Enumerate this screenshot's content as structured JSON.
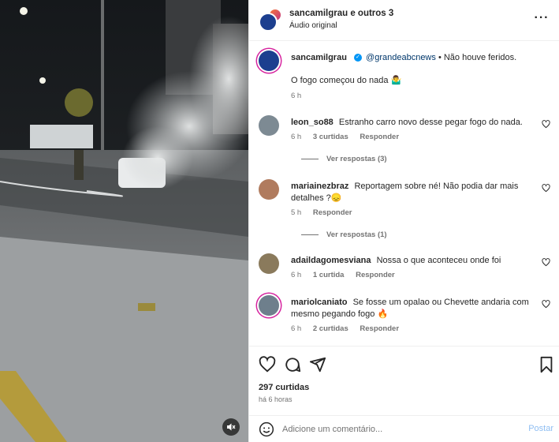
{
  "header": {
    "title": "sancamilgrau e outros 3",
    "subtitle": "Áudio original"
  },
  "caption": {
    "username": "sancamilgrau",
    "mention": "@grandeabcnews",
    "text1": "• Não houve feridos.",
    "text2": "O fogo começou do nada 🤷‍♂️",
    "time": "6 h"
  },
  "comments": [
    {
      "username": "leon_so88",
      "text": "Estranho carro novo desse pegar fogo do nada.",
      "time": "6 h",
      "likes": "3 curtidas",
      "reply_label": "Responder",
      "view_replies": "Ver respostas (3)"
    },
    {
      "username": "mariainezbraz",
      "text": "Reportagem sobre né! Não podia dar mais detalhes ?😞",
      "time": "5 h",
      "reply_label": "Responder",
      "view_replies": "Ver respostas (1)"
    },
    {
      "username": "adaildagomesviana",
      "text": "Nossa o que aconteceu onde foi",
      "time": "6 h",
      "likes": "1 curtida",
      "reply_label": "Responder"
    },
    {
      "username": "mariolcaniato",
      "text": "Se fosse um opalao ou Chevette andaria com mesmo pegando fogo 🔥",
      "time": "6 h",
      "likes": "2 curtidas",
      "reply_label": "Responder"
    }
  ],
  "post": {
    "likes": "297 curtidas",
    "time": "há 6 horas"
  },
  "add_comment": {
    "placeholder": "Adicione um comentário...",
    "post_label": "Postar"
  },
  "icons": [
    "mute-icon",
    "more-icon",
    "heart-icon",
    "comment-icon",
    "share-icon",
    "bookmark-icon",
    "emoji-icon"
  ],
  "colors": {
    "accent": "#0095f6",
    "post_disabled": "#8fbef2",
    "muted_text": "#737373"
  }
}
